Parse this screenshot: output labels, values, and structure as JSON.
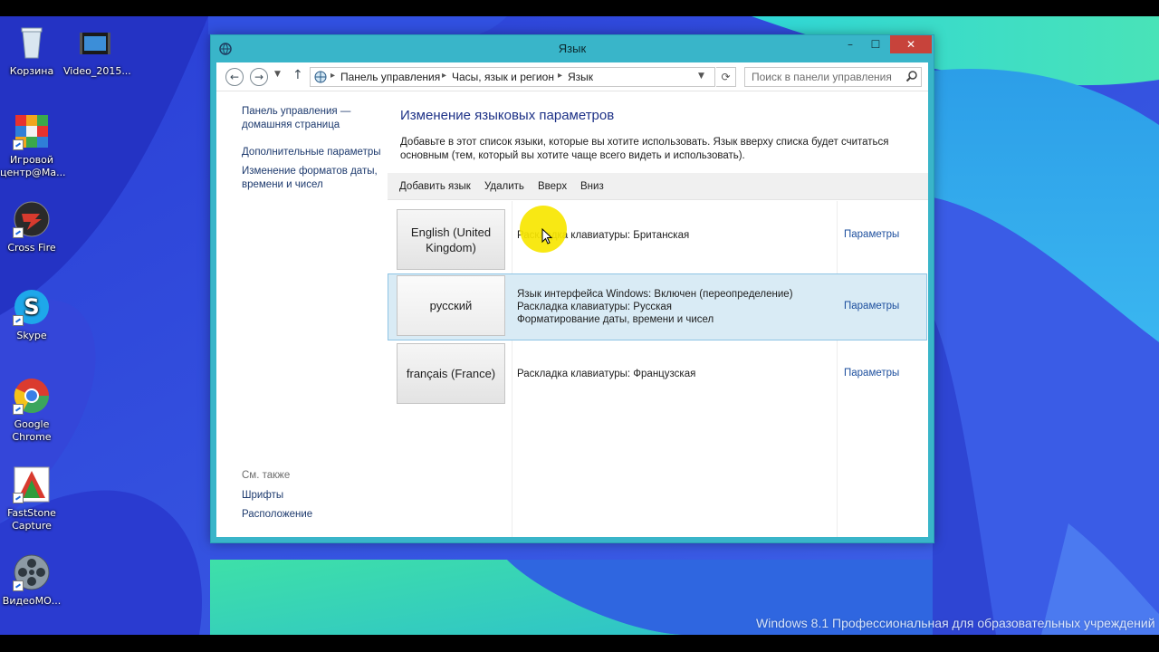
{
  "desktop": {
    "icons": [
      {
        "label": "Корзина"
      },
      {
        "label": "Video_2015..."
      },
      {
        "label": "Игровой центр@Ma..."
      },
      {
        "label": "Cross Fire"
      },
      {
        "label": "Skype"
      },
      {
        "label": "Google Chrome"
      },
      {
        "label": "FastStone Capture"
      },
      {
        "label": "ВидеоМО..."
      }
    ],
    "watermark": "Windows 8.1 Профессиональная для образовательных учреждений"
  },
  "window": {
    "title": "Язык",
    "controls": {
      "minimize": "–",
      "maximize": "☐",
      "close": "✕"
    },
    "nav": {
      "back": "←",
      "forward": "→",
      "up": "↑",
      "breadcrumb": [
        "Панель управления",
        "Часы, язык и регион",
        "Язык"
      ],
      "search_placeholder": "Поиск в панели управления"
    },
    "left_nav": {
      "home": "Панель управления — домашняя страница",
      "advanced": "Дополнительные параметры",
      "formats": "Изменение форматов даты, времени и чисел",
      "see_also": "См. также",
      "fonts": "Шрифты",
      "location": "Расположение"
    },
    "main": {
      "heading": "Изменение языковых параметров",
      "description": "Добавьте в этот список языки, которые вы хотите использовать. Язык вверху списка будет считаться основным (тем, который вы хотите чаще всего видеть и использовать).",
      "toolbar": {
        "add": "Добавить язык",
        "remove": "Удалить",
        "up": "Вверх",
        "down": "Вниз"
      },
      "languages": [
        {
          "name": "English (United Kingdom)",
          "details": [
            "Раскладка клавиатуры: Британская"
          ],
          "options": "Параметры",
          "selected": false
        },
        {
          "name": "русский",
          "details": [
            "Язык интерфейса Windows: Включен (переопределение)",
            "Раскладка клавиатуры: Русская",
            "Форматирование даты, времени и чисел"
          ],
          "options": "Параметры",
          "selected": true
        },
        {
          "name": "français (France)",
          "details": [
            "Раскладка клавиатуры: Французская"
          ],
          "options": "Параметры",
          "selected": false
        }
      ]
    }
  },
  "colors": {
    "window_frame": "#39b5c9",
    "link": "#1d3a6e",
    "heading": "#1e3287",
    "selection": "#d9ebf5",
    "close_button": "#c7433b",
    "cursor_highlight": "#f7e600"
  }
}
